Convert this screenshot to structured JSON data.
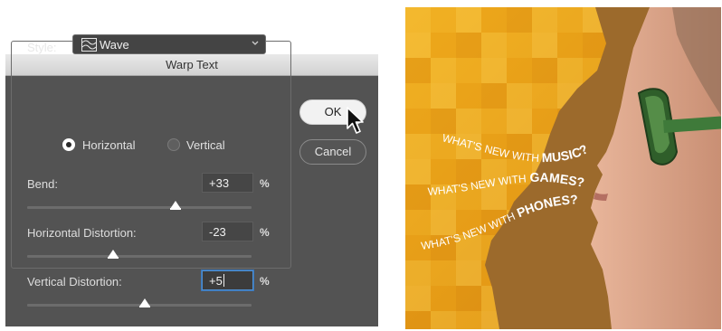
{
  "dialog": {
    "title": "Warp Text",
    "style_label": "Style:",
    "style_value": "Wave",
    "orientation": {
      "horizontal_label": "Horizontal",
      "vertical_label": "Vertical",
      "selected": "Horizontal"
    },
    "bend": {
      "label": "Bend:",
      "value": "+33",
      "unit": "%",
      "slider_fraction": 0.66
    },
    "horizontal_distortion": {
      "label": "Horizontal Distortion:",
      "value": "-23",
      "unit": "%",
      "slider_fraction": 0.385
    },
    "vertical_distortion": {
      "label": "Vertical Distortion:",
      "value": "+5",
      "unit": "%",
      "slider_fraction": 0.525
    },
    "ok_label": "OK",
    "cancel_label": "Cancel"
  },
  "artwork": {
    "lines": [
      {
        "prefix": "WHAT'S NEW WITH ",
        "word": "MUSIC?"
      },
      {
        "prefix": "WHAT'S NEW WITH ",
        "word": "GAMES?"
      },
      {
        "prefix": "WHAT'S NEW WITH ",
        "word": "PHONES?"
      }
    ]
  },
  "colors": {
    "dialog_bg": "#535353",
    "orange_light": "#f2b11f",
    "orange_dark": "#d98a12",
    "silhouette": "#9c6a2c",
    "glasses": "#3f7a3a"
  }
}
